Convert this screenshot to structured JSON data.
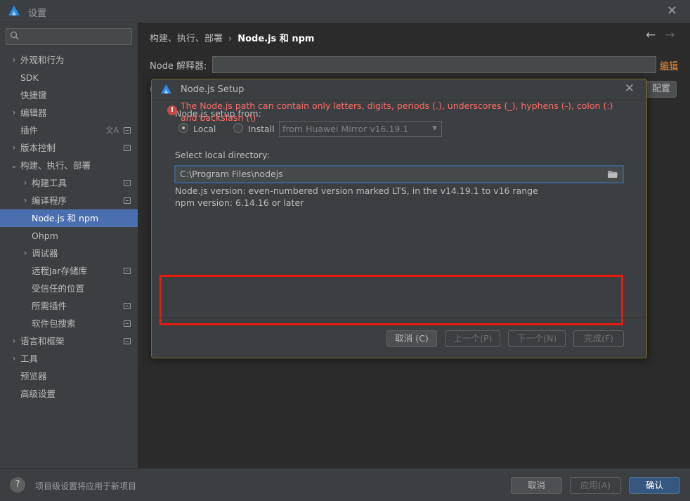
{
  "window": {
    "title": "设置",
    "close_glyph": "✕"
  },
  "search": {
    "placeholder": "",
    "value": ""
  },
  "sidebar": {
    "items": [
      {
        "label": "外观和行为",
        "chevron": "›",
        "badge": false
      },
      {
        "label": "SDK",
        "chevron": "",
        "badge": false
      },
      {
        "label": "快捷键",
        "chevron": "",
        "badge": false
      },
      {
        "label": "编辑器",
        "chevron": "›",
        "badge": false
      },
      {
        "label": "插件",
        "chevron": "",
        "badge": true,
        "translate": true
      },
      {
        "label": "版本控制",
        "chevron": "›",
        "badge": true
      },
      {
        "label": "构建、执行、部署",
        "chevron": "⌄",
        "badge": false
      },
      {
        "label": "构建工具",
        "chevron": "›",
        "badge": true
      },
      {
        "label": "编译程序",
        "chevron": "›",
        "badge": true
      },
      {
        "label": "Node.js 和 npm",
        "chevron": "",
        "badge": false,
        "selected": true
      },
      {
        "label": "Ohpm",
        "chevron": "",
        "badge": false
      },
      {
        "label": "调试器",
        "chevron": "›",
        "badge": false
      },
      {
        "label": "远程Jar存储库",
        "chevron": "",
        "badge": true
      },
      {
        "label": "受信任的位置",
        "chevron": "",
        "badge": false
      },
      {
        "label": "所需插件",
        "chevron": "",
        "badge": true
      },
      {
        "label": "软件包搜索",
        "chevron": "",
        "badge": true
      },
      {
        "label": "语言和框架",
        "chevron": "›",
        "badge": true
      },
      {
        "label": "工具",
        "chevron": "›",
        "badge": false
      },
      {
        "label": "预览器",
        "chevron": "",
        "badge": false
      },
      {
        "label": "高级设置",
        "chevron": "",
        "badge": false
      }
    ]
  },
  "main": {
    "breadcrumb": {
      "parent": "构建、执行、部署",
      "separator": "›",
      "current": "Node.js 和 npm"
    },
    "nav": {
      "back": "←",
      "forward": "→"
    },
    "node_interpreter": {
      "label": "Node 解释器:",
      "value": "",
      "edit_link": "编辑"
    },
    "config_button": "配置",
    "hidden_char": "("
  },
  "dialog": {
    "title": "Node.js Setup",
    "close_glyph": "✕",
    "setup_from_label": "Node.js setup from:",
    "radio_local": "Local",
    "radio_install": "Install",
    "mirror_value": "from Huawei Mirror v16.19.1",
    "select_dir_label": "Select local directory:",
    "dir_value": "C:\\Program Files\\nodejs",
    "version_line": "Node.js version: even-numbered version marked LTS, in the v14.19.1 to v16 range",
    "npm_line": "npm version: 6.14.16 or later",
    "error_icon": "!",
    "error_text": "The Node.js path can contain only letters, digits, periods (.), underscores (_), hyphens (-), colon (:) and backslash (\\)",
    "buttons": {
      "cancel": "取消 (C)",
      "prev": "上一个(P)",
      "next": "下一个(N)",
      "finish": "完成(F)"
    }
  },
  "footer": {
    "help": "?",
    "text": "项目级设置将应用于新项目",
    "cancel": "取消",
    "apply": "应用(A)",
    "ok": "确认"
  },
  "colors": {
    "accent": "#4b6eaf",
    "error": "#ff6b68",
    "error_outline": "#e8190f",
    "link": "#e08a3c",
    "primary_button": "#365880"
  }
}
